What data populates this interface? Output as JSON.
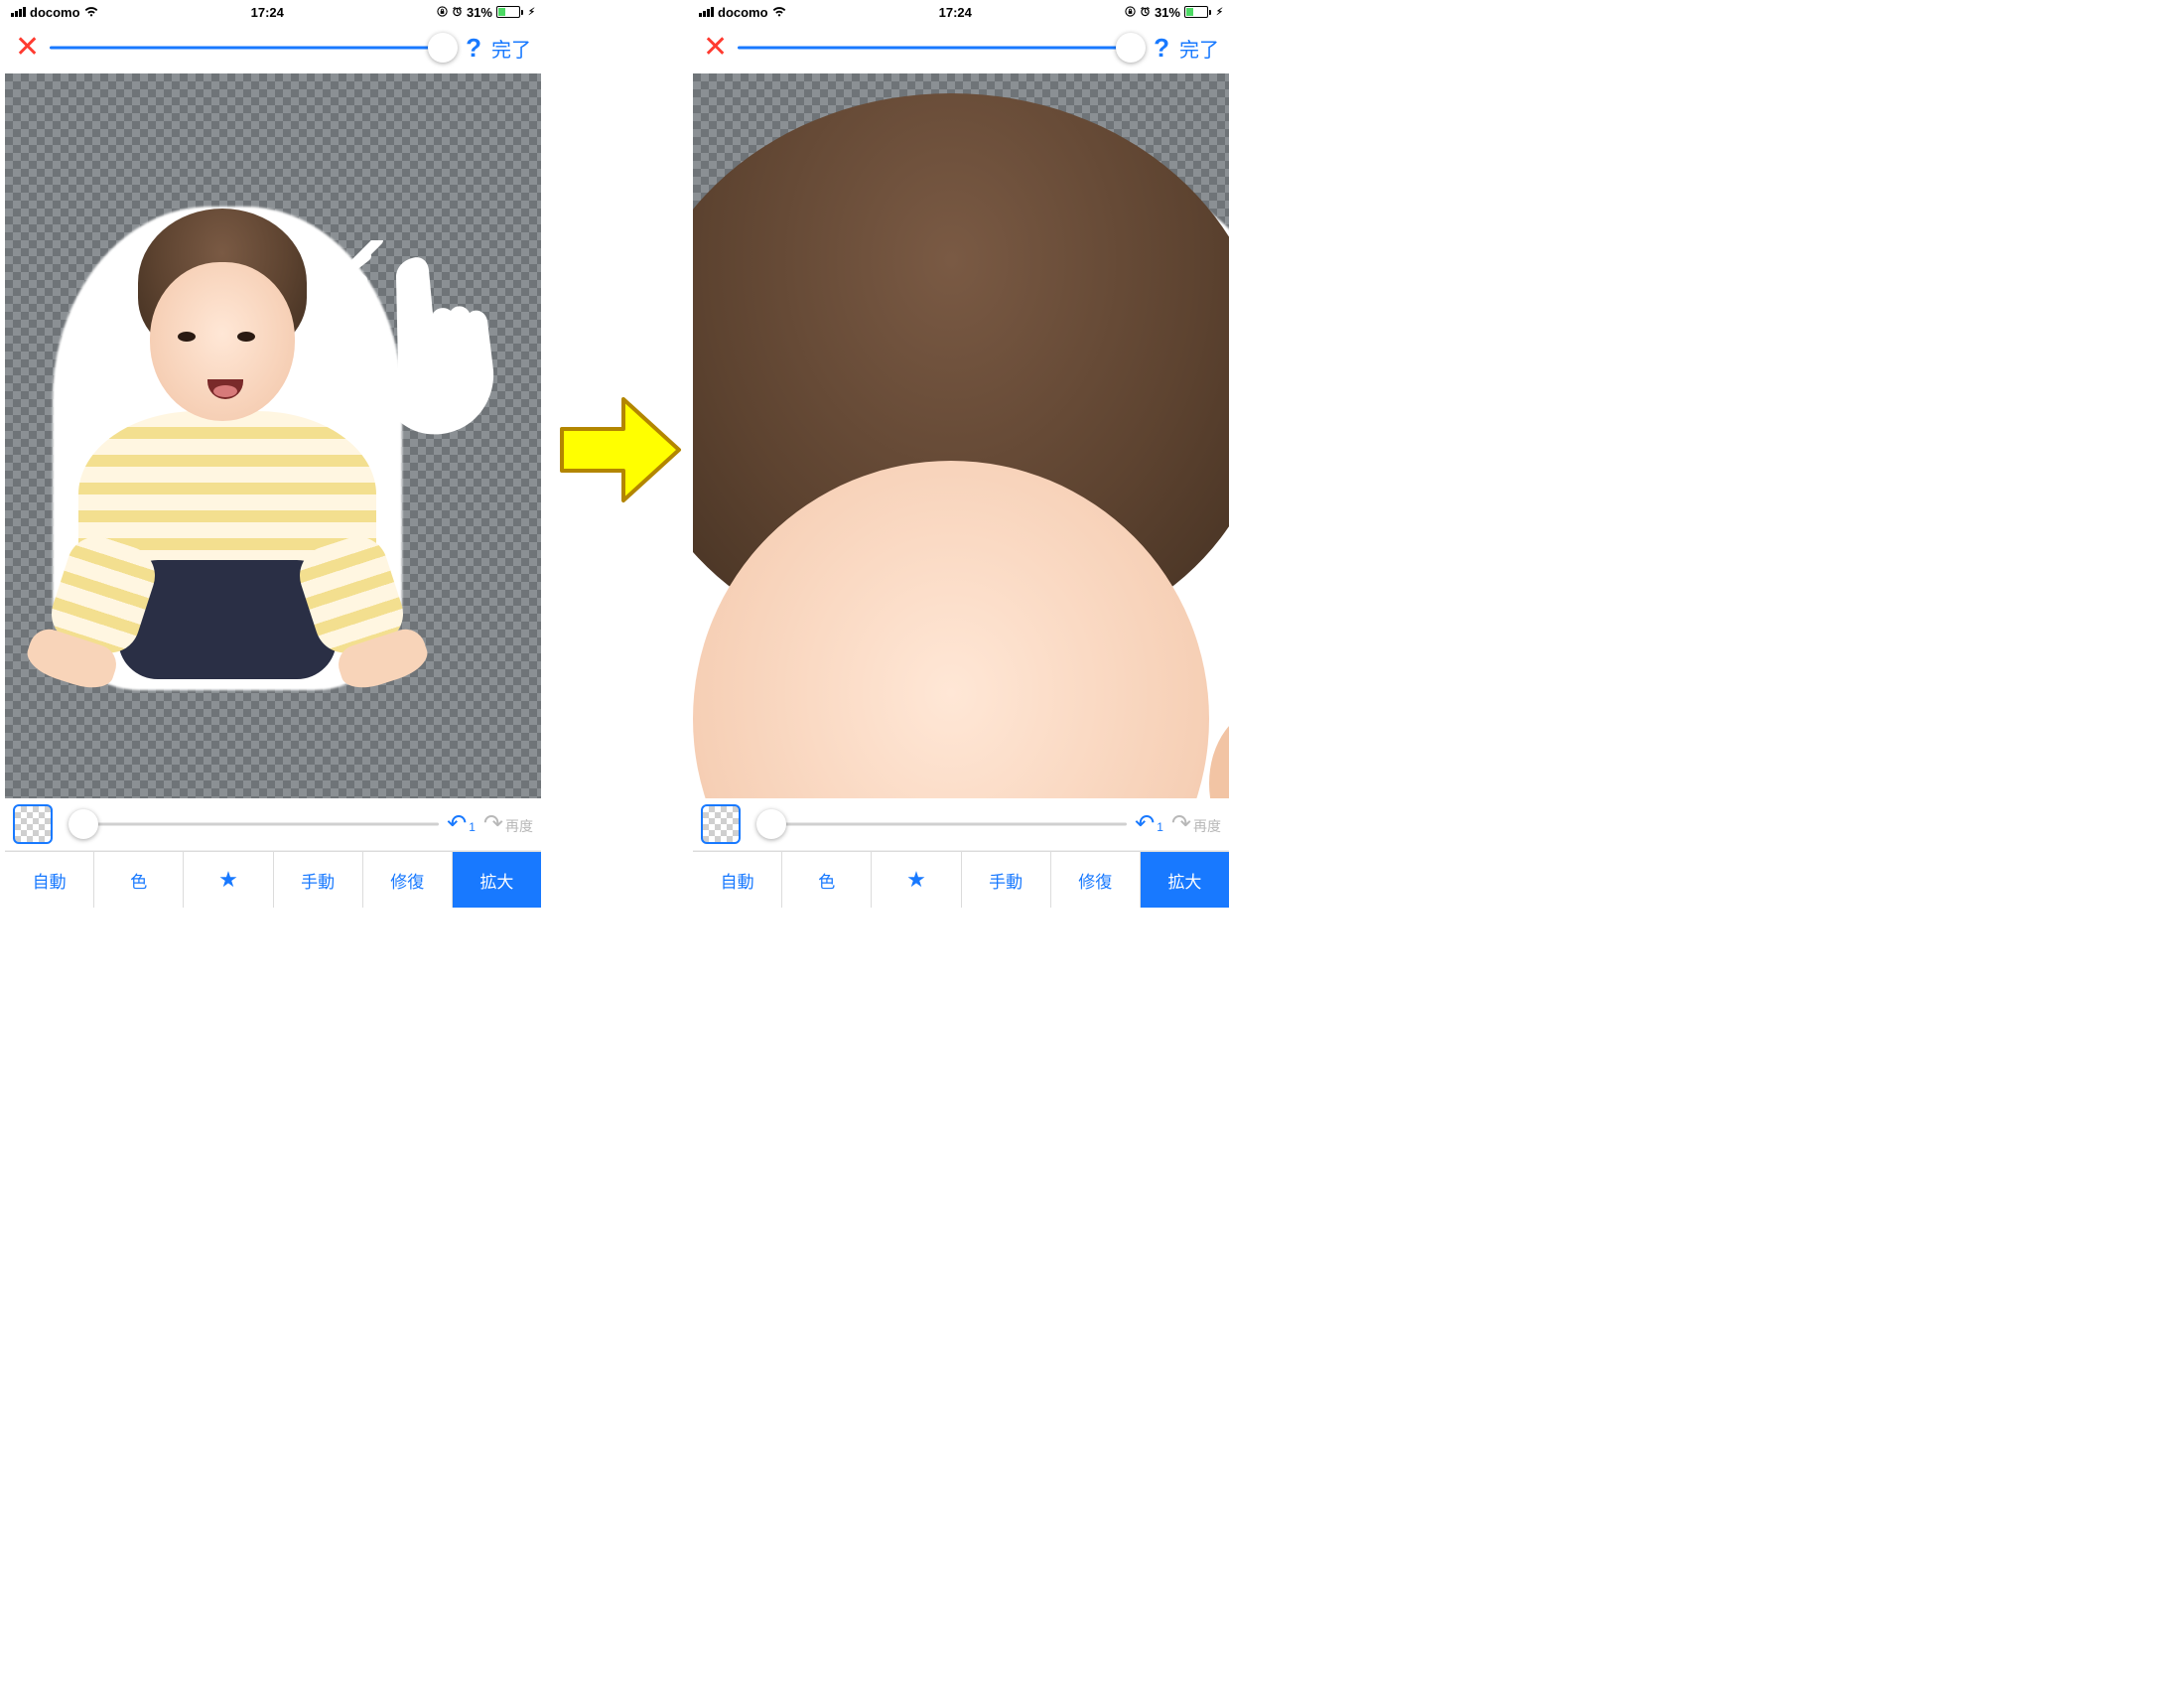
{
  "status": {
    "carrier": "docomo",
    "time": "17:24",
    "battery_pct": "31%"
  },
  "topbar": {
    "help": "?",
    "done": "完了"
  },
  "controls": {
    "undo_count": "1",
    "redo_label": "再度"
  },
  "tabs": [
    {
      "id": "auto",
      "label": "自動"
    },
    {
      "id": "color",
      "label": "色"
    },
    {
      "id": "star",
      "label": "★"
    },
    {
      "id": "manual",
      "label": "手動"
    },
    {
      "id": "repair",
      "label": "修復"
    },
    {
      "id": "zoom",
      "label": "拡大"
    }
  ],
  "active_tab": "zoom"
}
